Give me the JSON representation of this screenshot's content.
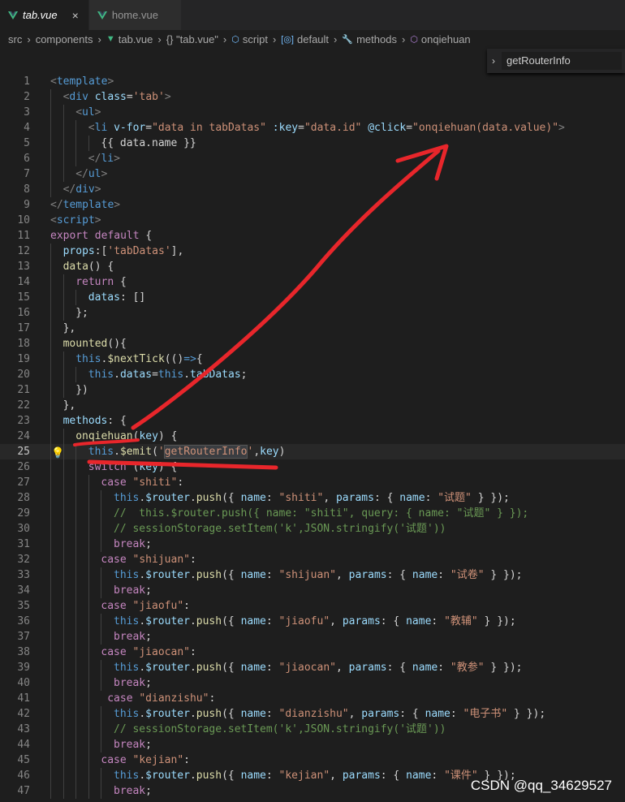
{
  "tabs": [
    {
      "label": "tab.vue",
      "active": true,
      "close": "×"
    },
    {
      "label": "home.vue",
      "active": false
    }
  ],
  "breadcrumb": [
    "src",
    "components",
    "tab.vue",
    "{} \"tab.vue\"",
    "script",
    "default",
    "methods",
    "onqiehuan"
  ],
  "sticky_search": "getRouterInfo",
  "watermark": "CSDN @qq_34629527",
  "colors": {
    "accent_red": "#e8262b",
    "vue_green": "#41b883"
  },
  "code": {
    "current_line": 25,
    "lines": [
      {
        "n": "1",
        "indent": 0,
        "tokens": [
          [
            "tag",
            "<"
          ],
          [
            "el",
            "template"
          ],
          [
            "tag",
            ">"
          ]
        ]
      },
      {
        "n": "2",
        "indent": 1,
        "tokens": [
          [
            "tag",
            "<"
          ],
          [
            "el",
            "div"
          ],
          [
            "pl",
            " "
          ],
          [
            "at",
            "class"
          ],
          [
            "pl",
            "="
          ],
          [
            "st",
            "'tab'"
          ],
          [
            "tag",
            ">"
          ]
        ]
      },
      {
        "n": "3",
        "indent": 2,
        "tokens": [
          [
            "tag",
            "<"
          ],
          [
            "el",
            "ul"
          ],
          [
            "tag",
            ">"
          ]
        ]
      },
      {
        "n": "4",
        "indent": 3,
        "tokens": [
          [
            "tag",
            "<"
          ],
          [
            "el",
            "li"
          ],
          [
            "pl",
            " "
          ],
          [
            "at",
            "v-for"
          ],
          [
            "pl",
            "="
          ],
          [
            "st",
            "\"data in tabDatas\""
          ],
          [
            "pl",
            " "
          ],
          [
            "at",
            ":key"
          ],
          [
            "pl",
            "="
          ],
          [
            "st",
            "\"data.id\""
          ],
          [
            "pl",
            " "
          ],
          [
            "at",
            "@click"
          ],
          [
            "pl",
            "="
          ],
          [
            "st",
            "\"onqiehuan(data.value)\""
          ],
          [
            "tag",
            ">"
          ]
        ]
      },
      {
        "n": "5",
        "indent": 4,
        "tokens": [
          [
            "pl",
            "{{ data.name }}"
          ]
        ]
      },
      {
        "n": "6",
        "indent": 3,
        "tokens": [
          [
            "tag",
            "</"
          ],
          [
            "el",
            "li"
          ],
          [
            "tag",
            ">"
          ]
        ]
      },
      {
        "n": "7",
        "indent": 2,
        "tokens": [
          [
            "tag",
            "</"
          ],
          [
            "el",
            "ul"
          ],
          [
            "tag",
            ">"
          ]
        ]
      },
      {
        "n": "8",
        "indent": 1,
        "tokens": [
          [
            "tag",
            "</"
          ],
          [
            "el",
            "div"
          ],
          [
            "tag",
            ">"
          ]
        ]
      },
      {
        "n": "9",
        "indent": 0,
        "tokens": [
          [
            "tag",
            "</"
          ],
          [
            "el",
            "template"
          ],
          [
            "tag",
            ">"
          ]
        ]
      },
      {
        "n": "10",
        "indent": 0,
        "tokens": [
          [
            "tag",
            "<"
          ],
          [
            "el",
            "script"
          ],
          [
            "tag",
            ">"
          ]
        ]
      },
      {
        "n": "11",
        "indent": 0,
        "tokens": [
          [
            "kw",
            "export"
          ],
          [
            "pl",
            " "
          ],
          [
            "kw",
            "default"
          ],
          [
            "pl",
            " {"
          ]
        ]
      },
      {
        "n": "12",
        "indent": 1,
        "tokens": [
          [
            "at",
            "props"
          ],
          [
            "pl",
            ":["
          ],
          [
            "st",
            "'tabDatas'"
          ],
          [
            "pl",
            "],"
          ]
        ]
      },
      {
        "n": "13",
        "indent": 1,
        "tokens": [
          [
            "fn",
            "data"
          ],
          [
            "pl",
            "() {"
          ]
        ]
      },
      {
        "n": "14",
        "indent": 2,
        "tokens": [
          [
            "kw",
            "return"
          ],
          [
            "pl",
            " {"
          ]
        ]
      },
      {
        "n": "15",
        "indent": 3,
        "tokens": [
          [
            "at",
            "datas"
          ],
          [
            "pl",
            ": []"
          ]
        ]
      },
      {
        "n": "16",
        "indent": 2,
        "tokens": [
          [
            "pl",
            "};"
          ]
        ]
      },
      {
        "n": "17",
        "indent": 1,
        "tokens": [
          [
            "pl",
            "},"
          ]
        ]
      },
      {
        "n": "18",
        "indent": 1,
        "tokens": [
          [
            "fn",
            "mounted"
          ],
          [
            "pl",
            "(){"
          ]
        ]
      },
      {
        "n": "19",
        "indent": 2,
        "tokens": [
          [
            "th",
            "this"
          ],
          [
            "pl",
            "."
          ],
          [
            "fn",
            "$nextTick"
          ],
          [
            "pl",
            "(()"
          ],
          [
            "th",
            "=>"
          ],
          [
            "pl",
            "{"
          ]
        ]
      },
      {
        "n": "20",
        "indent": 3,
        "tokens": [
          [
            "th",
            "this"
          ],
          [
            "pl",
            "."
          ],
          [
            "at",
            "datas"
          ],
          [
            "pl",
            "="
          ],
          [
            "th",
            "this"
          ],
          [
            "pl",
            "."
          ],
          [
            "at",
            "tabDatas"
          ],
          [
            "pl",
            ";"
          ]
        ]
      },
      {
        "n": "21",
        "indent": 2,
        "tokens": [
          [
            "pl",
            "})"
          ]
        ]
      },
      {
        "n": "22",
        "indent": 1,
        "tokens": [
          [
            "pl",
            "},"
          ]
        ]
      },
      {
        "n": "23",
        "indent": 1,
        "tokens": [
          [
            "at",
            "methods"
          ],
          [
            "pl",
            ": {"
          ]
        ]
      },
      {
        "n": "24",
        "indent": 2,
        "tokens": [
          [
            "fn",
            "onqiehuan"
          ],
          [
            "pl",
            "("
          ],
          [
            "at",
            "key"
          ],
          [
            "pl",
            ") {"
          ]
        ]
      },
      {
        "n": "25",
        "indent": 3,
        "tokens": [
          [
            "th",
            "this"
          ],
          [
            "pl",
            "."
          ],
          [
            "fn",
            "$emit"
          ],
          [
            "pl",
            "("
          ],
          [
            "st",
            "'"
          ],
          [
            "sthl",
            "getRouterInfo"
          ],
          [
            "st",
            "'"
          ],
          [
            "pl",
            ","
          ],
          [
            "at",
            "key"
          ],
          [
            "pl",
            ")"
          ]
        ]
      },
      {
        "n": "26",
        "indent": 3,
        "tokens": [
          [
            "kw",
            "switch"
          ],
          [
            "pl",
            " ("
          ],
          [
            "at",
            "key"
          ],
          [
            "pl",
            ") {"
          ]
        ]
      },
      {
        "n": "27",
        "indent": 4,
        "tokens": [
          [
            "kw",
            "case"
          ],
          [
            "pl",
            " "
          ],
          [
            "st",
            "\"shiti\""
          ],
          [
            "pl",
            ":"
          ]
        ]
      },
      {
        "n": "28",
        "indent": 5,
        "tokens": [
          [
            "th",
            "this"
          ],
          [
            "pl",
            "."
          ],
          [
            "at",
            "$router"
          ],
          [
            "pl",
            "."
          ],
          [
            "fn",
            "push"
          ],
          [
            "pl",
            "({ "
          ],
          [
            "at",
            "name"
          ],
          [
            "pl",
            ": "
          ],
          [
            "st",
            "\"shiti\""
          ],
          [
            "pl",
            ", "
          ],
          [
            "at",
            "params"
          ],
          [
            "pl",
            ": { "
          ],
          [
            "at",
            "name"
          ],
          [
            "pl",
            ": "
          ],
          [
            "st",
            "\"试题\""
          ],
          [
            "pl",
            " } });"
          ]
        ]
      },
      {
        "n": "29",
        "indent": 5,
        "tokens": [
          [
            "co",
            "//  this.$router.push({ name: \"shiti\", query: { name: \"试题\" } });"
          ]
        ]
      },
      {
        "n": "30",
        "indent": 5,
        "tokens": [
          [
            "co",
            "// sessionStorage.setItem('k',JSON.stringify('试题'))"
          ]
        ]
      },
      {
        "n": "31",
        "indent": 5,
        "tokens": [
          [
            "kw",
            "break"
          ],
          [
            "pl",
            ";"
          ]
        ]
      },
      {
        "n": "32",
        "indent": 4,
        "tokens": [
          [
            "kw",
            "case"
          ],
          [
            "pl",
            " "
          ],
          [
            "st",
            "\"shijuan\""
          ],
          [
            "pl",
            ":"
          ]
        ]
      },
      {
        "n": "33",
        "indent": 5,
        "tokens": [
          [
            "th",
            "this"
          ],
          [
            "pl",
            "."
          ],
          [
            "at",
            "$router"
          ],
          [
            "pl",
            "."
          ],
          [
            "fn",
            "push"
          ],
          [
            "pl",
            "({ "
          ],
          [
            "at",
            "name"
          ],
          [
            "pl",
            ": "
          ],
          [
            "st",
            "\"shijuan\""
          ],
          [
            "pl",
            ", "
          ],
          [
            "at",
            "params"
          ],
          [
            "pl",
            ": { "
          ],
          [
            "at",
            "name"
          ],
          [
            "pl",
            ": "
          ],
          [
            "st",
            "\"试卷\""
          ],
          [
            "pl",
            " } });"
          ]
        ]
      },
      {
        "n": "34",
        "indent": 5,
        "tokens": [
          [
            "kw",
            "break"
          ],
          [
            "pl",
            ";"
          ]
        ]
      },
      {
        "n": "35",
        "indent": 4,
        "tokens": [
          [
            "kw",
            "case"
          ],
          [
            "pl",
            " "
          ],
          [
            "st",
            "\"jiaofu\""
          ],
          [
            "pl",
            ":"
          ]
        ]
      },
      {
        "n": "36",
        "indent": 5,
        "tokens": [
          [
            "th",
            "this"
          ],
          [
            "pl",
            "."
          ],
          [
            "at",
            "$router"
          ],
          [
            "pl",
            "."
          ],
          [
            "fn",
            "push"
          ],
          [
            "pl",
            "({ "
          ],
          [
            "at",
            "name"
          ],
          [
            "pl",
            ": "
          ],
          [
            "st",
            "\"jiaofu\""
          ],
          [
            "pl",
            ", "
          ],
          [
            "at",
            "params"
          ],
          [
            "pl",
            ": { "
          ],
          [
            "at",
            "name"
          ],
          [
            "pl",
            ": "
          ],
          [
            "st",
            "\"教辅\""
          ],
          [
            "pl",
            " } });"
          ]
        ]
      },
      {
        "n": "37",
        "indent": 5,
        "tokens": [
          [
            "kw",
            "break"
          ],
          [
            "pl",
            ";"
          ]
        ]
      },
      {
        "n": "38",
        "indent": 4,
        "tokens": [
          [
            "kw",
            "case"
          ],
          [
            "pl",
            " "
          ],
          [
            "st",
            "\"jiaocan\""
          ],
          [
            "pl",
            ":"
          ]
        ]
      },
      {
        "n": "39",
        "indent": 5,
        "tokens": [
          [
            "th",
            "this"
          ],
          [
            "pl",
            "."
          ],
          [
            "at",
            "$router"
          ],
          [
            "pl",
            "."
          ],
          [
            "fn",
            "push"
          ],
          [
            "pl",
            "({ "
          ],
          [
            "at",
            "name"
          ],
          [
            "pl",
            ": "
          ],
          [
            "st",
            "\"jiaocan\""
          ],
          [
            "pl",
            ", "
          ],
          [
            "at",
            "params"
          ],
          [
            "pl",
            ": { "
          ],
          [
            "at",
            "name"
          ],
          [
            "pl",
            ": "
          ],
          [
            "st",
            "\"教参\""
          ],
          [
            "pl",
            " } });"
          ]
        ]
      },
      {
        "n": "40",
        "indent": 5,
        "tokens": [
          [
            "kw",
            "break"
          ],
          [
            "pl",
            ";"
          ]
        ]
      },
      {
        "n": "41",
        "indent": 4,
        "tokens": [
          [
            "pl",
            " "
          ],
          [
            "kw",
            "case"
          ],
          [
            "pl",
            " "
          ],
          [
            "st",
            "\"dianzishu\""
          ],
          [
            "pl",
            ":"
          ]
        ]
      },
      {
        "n": "42",
        "indent": 5,
        "tokens": [
          [
            "th",
            "this"
          ],
          [
            "pl",
            "."
          ],
          [
            "at",
            "$router"
          ],
          [
            "pl",
            "."
          ],
          [
            "fn",
            "push"
          ],
          [
            "pl",
            "({ "
          ],
          [
            "at",
            "name"
          ],
          [
            "pl",
            ": "
          ],
          [
            "st",
            "\"dianzishu\""
          ],
          [
            "pl",
            ", "
          ],
          [
            "at",
            "params"
          ],
          [
            "pl",
            ": { "
          ],
          [
            "at",
            "name"
          ],
          [
            "pl",
            ": "
          ],
          [
            "st",
            "\"电子书\""
          ],
          [
            "pl",
            " } });"
          ]
        ]
      },
      {
        "n": "43",
        "indent": 5,
        "tokens": [
          [
            "co",
            "// sessionStorage.setItem('k',JSON.stringify('试题'))"
          ]
        ]
      },
      {
        "n": "44",
        "indent": 5,
        "tokens": [
          [
            "kw",
            "break"
          ],
          [
            "pl",
            ";"
          ]
        ]
      },
      {
        "n": "45",
        "indent": 4,
        "tokens": [
          [
            "kw",
            "case"
          ],
          [
            "pl",
            " "
          ],
          [
            "st",
            "\"kejian\""
          ],
          [
            "pl",
            ":"
          ]
        ]
      },
      {
        "n": "46",
        "indent": 5,
        "tokens": [
          [
            "th",
            "this"
          ],
          [
            "pl",
            "."
          ],
          [
            "at",
            "$router"
          ],
          [
            "pl",
            "."
          ],
          [
            "fn",
            "push"
          ],
          [
            "pl",
            "({ "
          ],
          [
            "at",
            "name"
          ],
          [
            "pl",
            ": "
          ],
          [
            "st",
            "\"kejian\""
          ],
          [
            "pl",
            ", "
          ],
          [
            "at",
            "params"
          ],
          [
            "pl",
            ": { "
          ],
          [
            "at",
            "name"
          ],
          [
            "pl",
            ": "
          ],
          [
            "st",
            "\"课件\""
          ],
          [
            "pl",
            " } });"
          ]
        ]
      },
      {
        "n": "47",
        "indent": 5,
        "tokens": [
          [
            "kw",
            "break"
          ],
          [
            "pl",
            ";"
          ]
        ]
      }
    ]
  }
}
